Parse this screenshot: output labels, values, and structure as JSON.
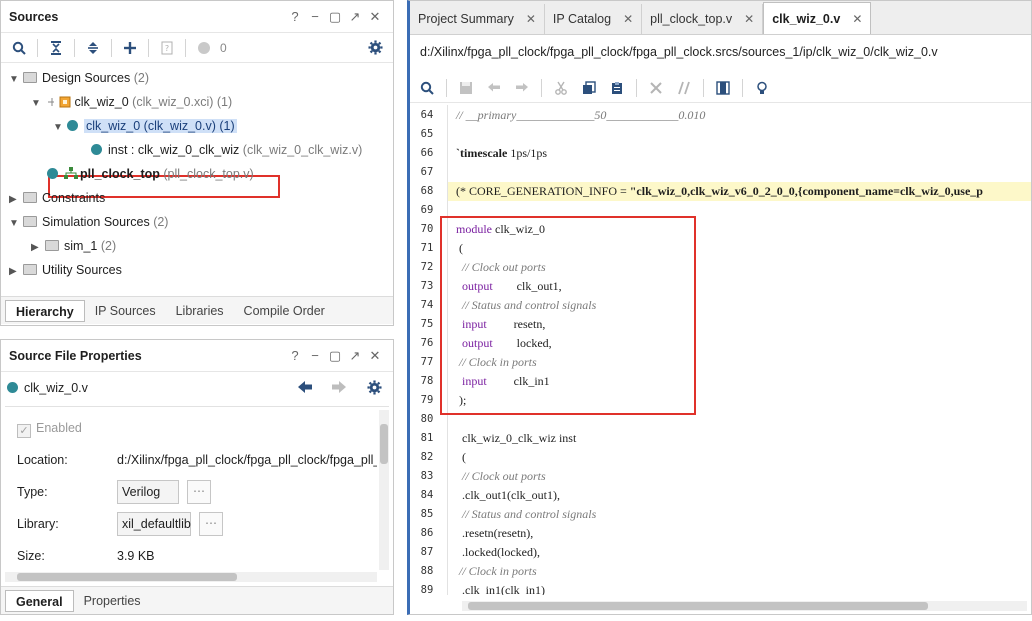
{
  "sources": {
    "title": "Sources",
    "header_controls": [
      "?",
      "−",
      "▢",
      "↗",
      "✕"
    ],
    "toolbar_badge": "0",
    "tree": {
      "design_sources": {
        "label": "Design Sources",
        "count": "(2)"
      },
      "clk_wiz_0_xci": {
        "label": "clk_wiz_0",
        "detail": "(clk_wiz_0.xci) (1)"
      },
      "clk_wiz_0_v": {
        "label": "clk_wiz_0 (clk_wiz_0.v) (1)"
      },
      "inst": {
        "label": "inst : clk_wiz_0_clk_wiz",
        "detail": "(clk_wiz_0_clk_wiz.v)"
      },
      "pll_clock_top": {
        "label": "pll_clock_top",
        "detail": "(pll_clock_top.v)"
      },
      "constraints": {
        "label": "Constraints"
      },
      "simulation_sources": {
        "label": "Simulation Sources",
        "count": "(2)"
      },
      "sim_1": {
        "label": "sim_1",
        "count": "(2)"
      },
      "utility_sources": {
        "label": "Utility Sources"
      }
    },
    "tabs": [
      "Hierarchy",
      "IP Sources",
      "Libraries",
      "Compile Order"
    ]
  },
  "properties": {
    "title": "Source File Properties",
    "file": "clk_wiz_0.v",
    "enabled_label": "Enabled",
    "location_label": "Location:",
    "location_value": "d:/Xilinx/fpga_pll_clock/fpga_pll_clock/fpga_pll_c",
    "type_label": "Type:",
    "type_value": "Verilog",
    "library_label": "Library:",
    "library_value": "xil_defaultlib",
    "size_label": "Size:",
    "size_value": "3.9 KB",
    "ellipsis": "⋯",
    "tabs": [
      "General",
      "Properties"
    ]
  },
  "editor": {
    "tabs": [
      {
        "label": "Project Summary"
      },
      {
        "label": "IP Catalog"
      },
      {
        "label": "pll_clock_top.v"
      },
      {
        "label": "clk_wiz_0.v"
      }
    ],
    "path": "d:/Xilinx/fpga_pll_clock/fpga_pll_clock/fpga_pll_clock.srcs/sources_1/ip/clk_wiz_0/clk_wiz_0.v",
    "lines": [
      {
        "n": "64",
        "text": "// __primary_____________50____________0.010"
      },
      {
        "n": "65",
        "text": ""
      },
      {
        "n": "66",
        "text": "`timescale 1ps/1ps"
      },
      {
        "n": "67",
        "text": ""
      },
      {
        "n": "68",
        "text": "(* CORE_GENERATION_INFO = \"clk_wiz_0,clk_wiz_v6_0_2_0_0,{component_name=clk_wiz_0,use_p"
      },
      {
        "n": "69",
        "text": ""
      },
      {
        "n": "70",
        "text": "module clk_wiz_0"
      },
      {
        "n": "71",
        "text": " ("
      },
      {
        "n": "72",
        "text": "  // Clock out ports"
      },
      {
        "n": "73",
        "text": "  output        clk_out1,"
      },
      {
        "n": "74",
        "text": "  // Status and control signals"
      },
      {
        "n": "75",
        "text": "  input         resetn,"
      },
      {
        "n": "76",
        "text": "  output        locked,"
      },
      {
        "n": "77",
        "text": " // Clock in ports"
      },
      {
        "n": "78",
        "text": "  input         clk_in1"
      },
      {
        "n": "79",
        "text": " );"
      },
      {
        "n": "80",
        "text": ""
      },
      {
        "n": "81",
        "text": "  clk_wiz_0_clk_wiz inst"
      },
      {
        "n": "82",
        "text": "  ("
      },
      {
        "n": "83",
        "text": "  // Clock out ports"
      },
      {
        "n": "84",
        "text": "  .clk_out1(clk_out1),"
      },
      {
        "n": "85",
        "text": "  // Status and control signals"
      },
      {
        "n": "86",
        "text": "  .resetn(resetn),"
      },
      {
        "n": "87",
        "text": "  .locked(locked),"
      },
      {
        "n": "88",
        "text": " // Clock in ports"
      },
      {
        "n": "89",
        "text": "  .clk_in1(clk_in1)"
      }
    ]
  },
  "colors": {
    "accent": "#3b6db5",
    "highlight_box": "#e0312a",
    "keyword": "#7a1fa0",
    "comment": "#7a7a7a",
    "ip_dot": "#2e8a96"
  }
}
